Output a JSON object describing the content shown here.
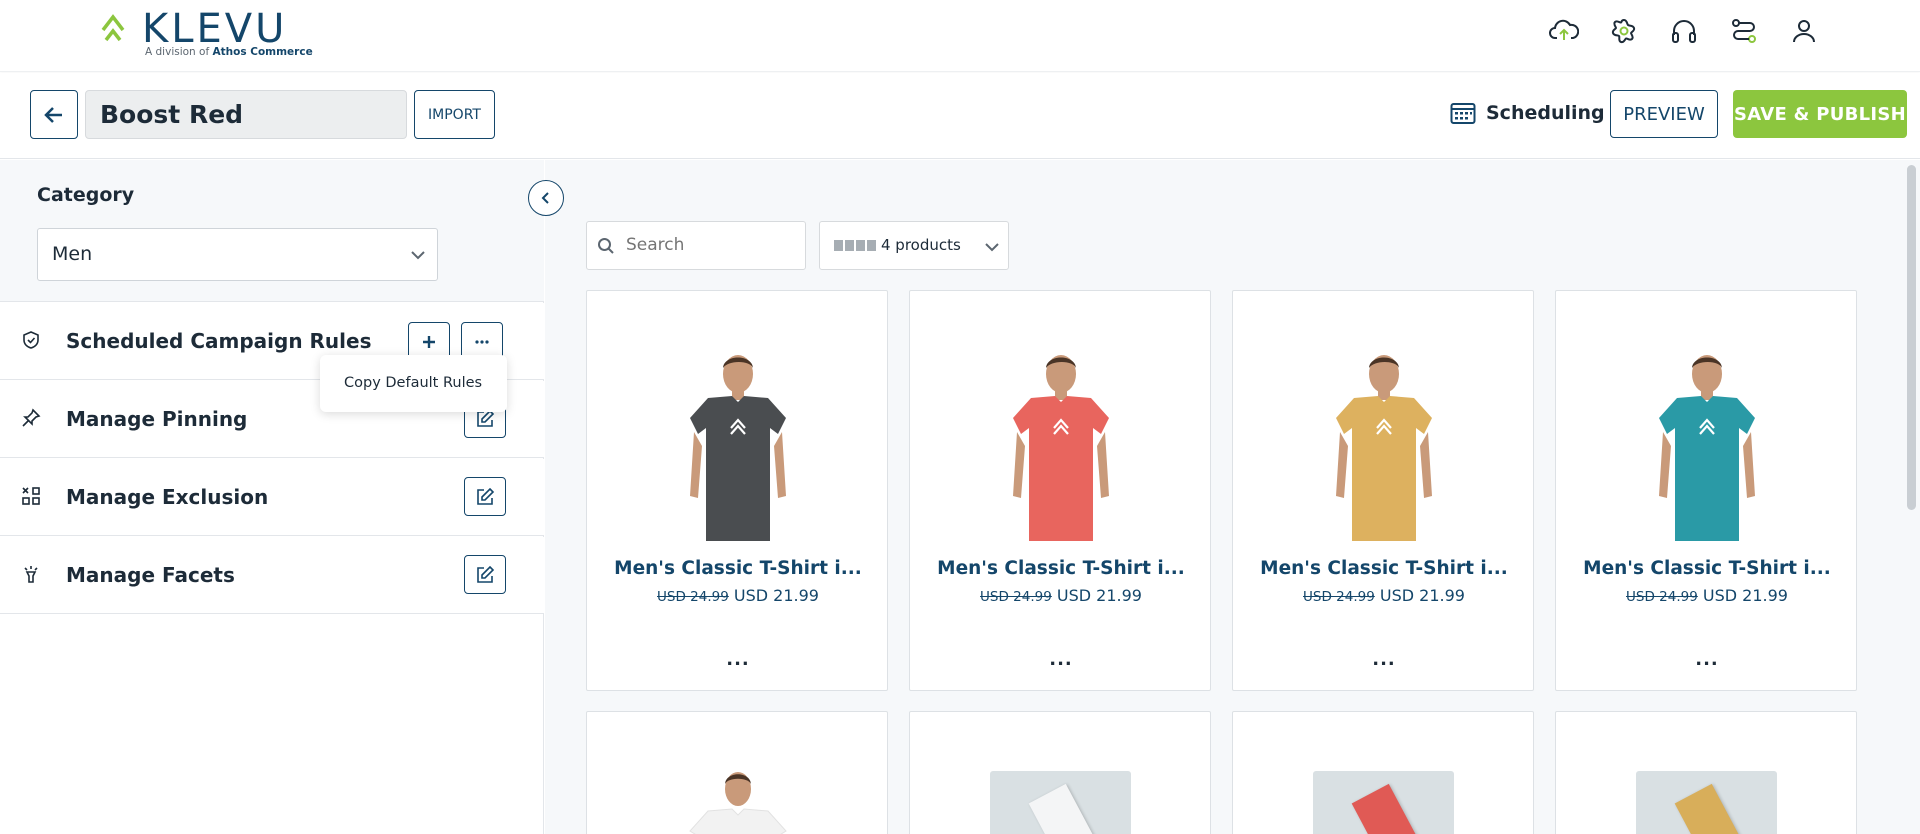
{
  "brand": {
    "logo_text": "KLEVU",
    "subtitle_prefix": "A division of",
    "subtitle_company": "Athos Commerce",
    "accent_color": "#8cc63e",
    "primary_color": "#14466a"
  },
  "top_icons": [
    "cloud-upload-icon",
    "settings-flower-icon",
    "headset-icon",
    "integration-icon",
    "user-icon"
  ],
  "header": {
    "campaign_name": "Boost Red",
    "import_label": "IMPORT",
    "scheduling_label": "Scheduling",
    "preview_label": "PREVIEW",
    "publish_label": "SAVE & PUBLISH"
  },
  "left_panel": {
    "category_title": "Category",
    "category_value": "Men",
    "rules": [
      {
        "label": "Scheduled Campaign Rules",
        "icon": "shield-check-icon"
      },
      {
        "label": "Manage Pinning",
        "icon": "pin-icon"
      },
      {
        "label": "Manage Exclusion",
        "icon": "exclusion-icon"
      },
      {
        "label": "Manage Facets",
        "icon": "facets-icon"
      }
    ],
    "popup_item": "Copy Default Rules"
  },
  "toolbar": {
    "search_placeholder": "Search",
    "product_count": "4 products"
  },
  "products": [
    {
      "title": "Men's Classic T-Shirt i...",
      "old_price": "USD 24.99",
      "price": "USD 21.99",
      "shirt_color": "#4a4d50",
      "more": "..."
    },
    {
      "title": "Men's Classic T-Shirt i...",
      "old_price": "USD 24.99",
      "price": "USD 21.99",
      "shirt_color": "#e8655e",
      "more": "..."
    },
    {
      "title": "Men's Classic T-Shirt i...",
      "old_price": "USD 24.99",
      "price": "USD 21.99",
      "shirt_color": "#ddb15f",
      "more": "..."
    },
    {
      "title": "Men's Classic T-Shirt i...",
      "old_price": "USD 24.99",
      "price": "USD 21.99",
      "shirt_color": "#2a9aa6",
      "more": "..."
    }
  ],
  "second_row_products": [
    {
      "kind": "tshirt",
      "color": "#f2f2f2"
    },
    {
      "kind": "package",
      "color": "#f4f5f6"
    },
    {
      "kind": "package",
      "color": "#e05a55"
    },
    {
      "kind": "package",
      "color": "#d8ae5a"
    }
  ]
}
